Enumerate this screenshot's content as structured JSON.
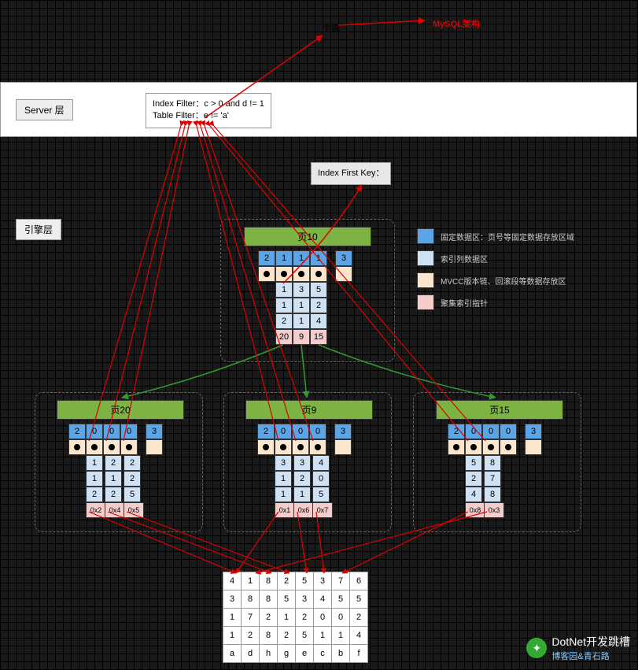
{
  "labels": {
    "server_layer": "Server 层",
    "engine_layer": "引擎层",
    "index_filter": "Index Filter：c > 0 and d != 1",
    "table_filter": "Table Filter：e != 'a'",
    "index_first_key": "Index First Key：",
    "title_top": "主键",
    "red_anno_top": "MySQL架构"
  },
  "legend": {
    "blue": "固定数据区：页号等固定数据存放区域",
    "lightblue": "索引列数据区",
    "cream": "MVCC版本链、回滚段等数据存放区",
    "pink": "聚集索引指针"
  },
  "chart_data": {
    "type": "diagram",
    "root_page": {
      "id": "页10",
      "header_row": [
        2,
        1,
        1,
        1,
        3
      ],
      "columns": [
        {
          "values": [
            1,
            1,
            2
          ],
          "footer": "20"
        },
        {
          "values": [
            3,
            1,
            1
          ],
          "footer": "9"
        },
        {
          "values": [
            5,
            2,
            4
          ],
          "footer": "15"
        }
      ]
    },
    "leaf_pages": [
      {
        "id": "页20",
        "header_row": [
          2,
          0,
          0,
          0,
          3
        ],
        "columns": [
          {
            "values": [
              1,
              1,
              2
            ],
            "footer": "0x2"
          },
          {
            "values": [
              2,
              1,
              2
            ],
            "footer": "0x4"
          },
          {
            "values": [
              2,
              2,
              5
            ],
            "footer": "0x5"
          }
        ]
      },
      {
        "id": "页9",
        "header_row": [
          2,
          0,
          0,
          0,
          3
        ],
        "columns": [
          {
            "values": [
              3,
              1,
              1
            ],
            "footer": "0x1"
          },
          {
            "values": [
              3,
              2,
              1
            ],
            "footer": "0x6"
          },
          {
            "values": [
              4,
              0,
              5
            ],
            "footer": "0x7"
          }
        ]
      },
      {
        "id": "页15",
        "header_row": [
          2,
          0,
          0,
          0,
          3
        ],
        "columns": [
          {
            "values": [
              5,
              2,
              4
            ],
            "footer": "0x8"
          },
          {
            "values": [
              8,
              7,
              8
            ],
            "footer": "0x3"
          }
        ]
      }
    ],
    "bottom_table": [
      [
        4,
        1,
        8,
        2,
        5,
        3,
        7,
        6
      ],
      [
        3,
        8,
        8,
        5,
        3,
        4,
        5,
        5
      ],
      [
        1,
        7,
        2,
        1,
        2,
        0,
        0,
        2
      ],
      [
        1,
        2,
        8,
        2,
        5,
        1,
        1,
        4
      ],
      [
        "a",
        "d",
        "h",
        "g",
        "e",
        "c",
        "b",
        "f"
      ]
    ]
  },
  "watermark": "DotNet开发跳槽",
  "watermark2": "博客园&青石路"
}
